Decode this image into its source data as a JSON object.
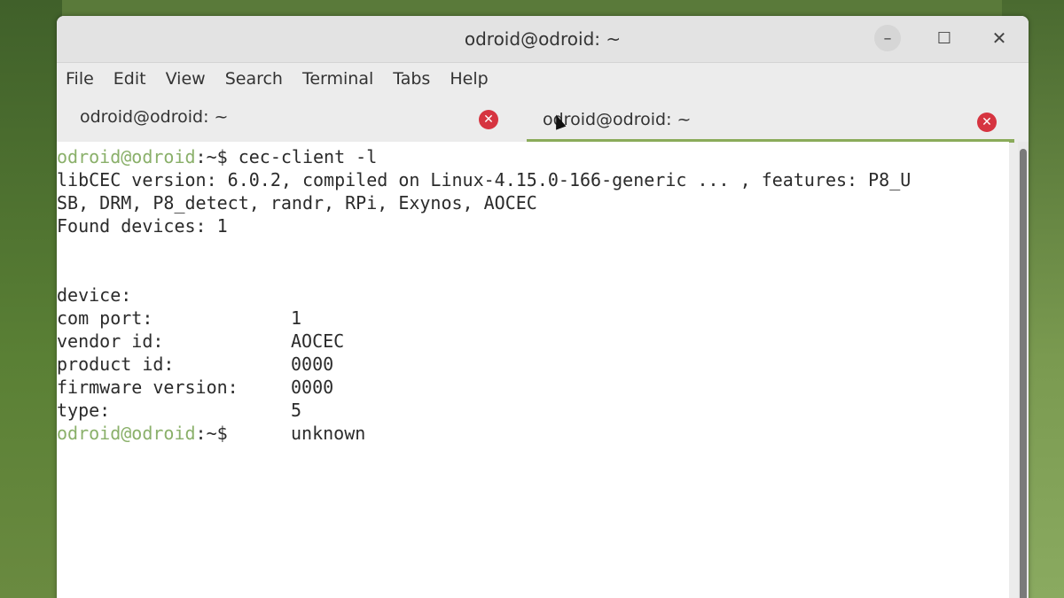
{
  "window": {
    "title": "odroid@odroid: ~",
    "minimize_icon": "–",
    "maximize_icon": "☐",
    "close_icon": "✕"
  },
  "menu": [
    "File",
    "Edit",
    "View",
    "Search",
    "Terminal",
    "Tabs",
    "Help"
  ],
  "tabs": [
    {
      "label": "odroid@odroid: ~",
      "active": false
    },
    {
      "label": "odroid@odroid: ~",
      "active": true
    }
  ],
  "tab_close_icon": "✕",
  "terminal": {
    "prompt_user": "odroid@odroid",
    "prompt_suffix": ":~$",
    "command": " cec-client -l",
    "output_lines": [
      "libCEC version: 6.0.2, compiled on Linux-4.15.0-166-generic ... , features: P8_U",
      "SB, DRM, P8_detect, randr, RPi, Exynos, AOCEC",
      "Found devices: 1"
    ],
    "device_info": [
      {
        "key": "device:",
        "value": "1"
      },
      {
        "key": "com port:",
        "value": "AOCEC"
      },
      {
        "key": "vendor id:",
        "value": "0000"
      },
      {
        "key": "product id:",
        "value": "0000"
      },
      {
        "key": "firmware version:",
        "value": "5"
      },
      {
        "key": "type:",
        "value": "unknown"
      }
    ],
    "final_prompt_user": "odroid@odroid",
    "final_prompt_suffix": ":~$"
  },
  "colors": {
    "prompt_user": "#8ab06a",
    "tab_close": "#d63440",
    "active_tab_underline": "#8aab5a"
  }
}
